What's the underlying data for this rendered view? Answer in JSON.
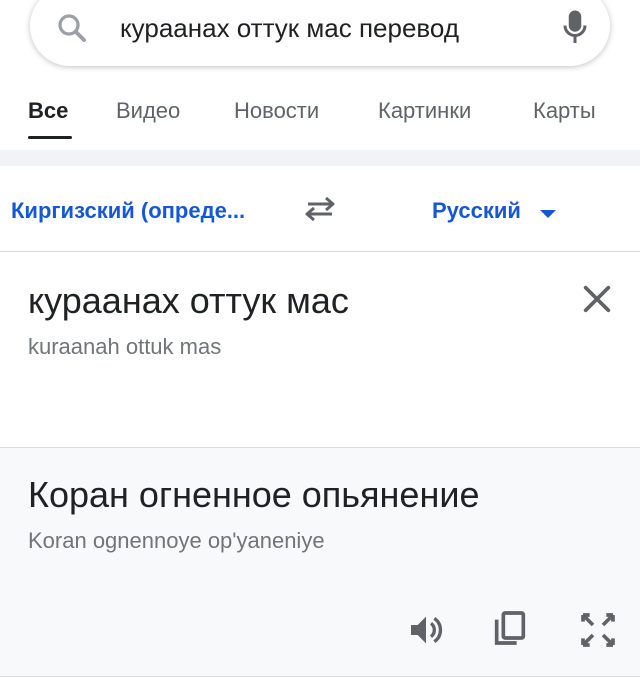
{
  "search": {
    "query": "кураанах оттук мас перевод",
    "search_icon": "search-icon",
    "mic_icon": "mic-icon"
  },
  "tabs": [
    {
      "label": "Все",
      "active": true
    },
    {
      "label": "Видео",
      "active": false
    },
    {
      "label": "Новости",
      "active": false
    },
    {
      "label": "Картинки",
      "active": false
    },
    {
      "label": "Карты",
      "active": false
    }
  ],
  "translator": {
    "source_language": "Киргизский (опреде...",
    "target_language": "Русский",
    "swap_icon": "swap-arrows-icon",
    "source_text": "кураанах оттук мас",
    "source_transliteration": "kuraanah ottuk mas",
    "target_text": "Коран огненное опьянение",
    "target_transliteration": "Koran ognennoye op'yaneniye",
    "clear_icon": "close-icon",
    "actions": [
      {
        "icon": "speaker-icon"
      },
      {
        "icon": "copy-icon"
      },
      {
        "icon": "fullscreen-icon"
      }
    ]
  },
  "colors": {
    "link_blue": "#1558d6",
    "text_primary": "#202124",
    "text_secondary": "#70757a",
    "icon_gray": "#5f6368",
    "panel_bg": "#f8f9fa"
  }
}
